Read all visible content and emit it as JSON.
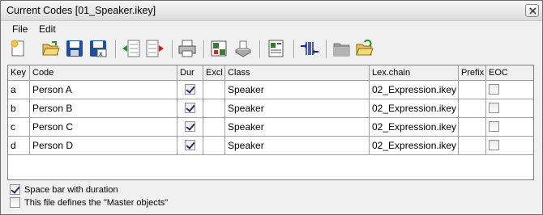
{
  "window": {
    "title": "Current Codes [01_Speaker.ikey]"
  },
  "menu": [
    "File",
    "Edit"
  ],
  "toolbar": [
    {
      "name": "new-file-icon"
    },
    {
      "name": "open-folder-icon"
    },
    {
      "name": "save-icon"
    },
    {
      "name": "save-as-icon"
    },
    {
      "name": "import-codes-icon"
    },
    {
      "name": "export-codes-icon"
    },
    {
      "name": "print-icon"
    },
    {
      "name": "print-preview-icon"
    },
    {
      "name": "properties-icon"
    },
    {
      "name": "column-settings-icon"
    },
    {
      "name": "folder-disabled-icon"
    },
    {
      "name": "open-folder-alt-icon"
    }
  ],
  "grid": {
    "columns": [
      "Key",
      "Code",
      "Dur",
      "Excl",
      "Class",
      "Lex.chain",
      "Prefix",
      "EOC"
    ],
    "rows": [
      {
        "key": "a",
        "code": "Person A",
        "dur": true,
        "excl": "",
        "class": "Speaker",
        "lex": "02_Expression.ikey",
        "prefix": "",
        "eoc": false
      },
      {
        "key": "b",
        "code": "Person B",
        "dur": true,
        "excl": "",
        "class": "Speaker",
        "lex": "02_Expression.ikey",
        "prefix": "",
        "eoc": false
      },
      {
        "key": "c",
        "code": "Person C",
        "dur": true,
        "excl": "",
        "class": "Speaker",
        "lex": "02_Expression.ikey",
        "prefix": "",
        "eoc": false
      },
      {
        "key": "d",
        "code": "Person D",
        "dur": true,
        "excl": "",
        "class": "Speaker",
        "lex": "02_Expression.ikey",
        "prefix": "",
        "eoc": false
      }
    ]
  },
  "options": [
    {
      "label": "Space bar with duration",
      "checked": true
    },
    {
      "label": "This file defines the \"Master objects\"",
      "checked": false
    }
  ]
}
